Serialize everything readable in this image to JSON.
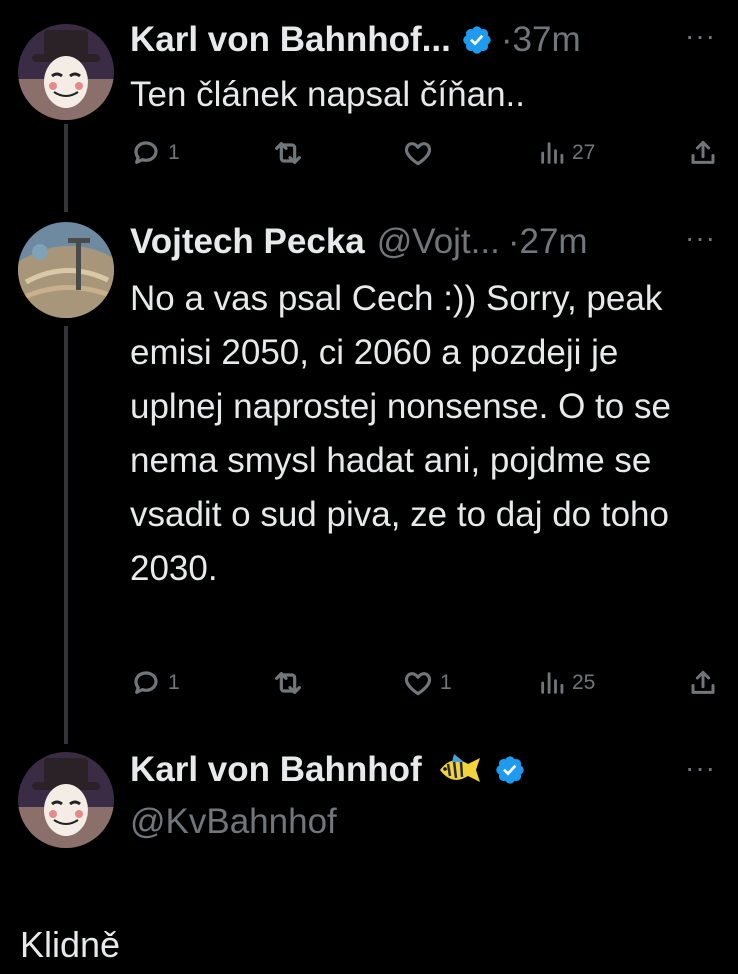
{
  "tweets": [
    {
      "name": "Karl von Bahnhof...",
      "time": "37m",
      "separator": "·",
      "text": "Ten článek napsal číňan..",
      "replies": "1",
      "retweets": "",
      "likes": "",
      "views": "27"
    },
    {
      "name": "Vojtech Pecka",
      "handle": "@Vojt...",
      "time": "27m",
      "separator": "·",
      "text": "No a vas psal Cech :)) Sorry, peak emisi 2050, ci 2060 a pozdeji je uplnej naprostej nonsense. O to se nema smysl hadat ani, pojdme se vsadit o sud piva, ze to daj do toho 2030.",
      "replies": "1",
      "retweets": "",
      "likes": "1",
      "views": "25"
    }
  ],
  "main": {
    "name": "Karl von Bahnhof",
    "handle": "@KvBahnhof",
    "text": "Klidně"
  },
  "more_glyph": "···",
  "colors": {
    "background": "#000000",
    "text": "#e7e9ea",
    "muted": "#71767b",
    "verified": "#1d9bf0"
  }
}
